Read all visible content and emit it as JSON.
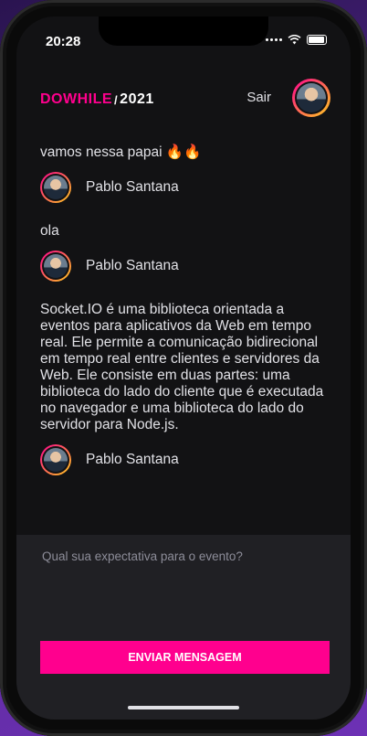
{
  "status_bar": {
    "time": "20:28"
  },
  "header": {
    "logo": {
      "prefix": "DOWHILE",
      "separator": "/",
      "year": "2021"
    },
    "signout_label": "Sair"
  },
  "messages": [
    {
      "text": "vamos nessa papai 🔥🔥",
      "user": "Pablo Santana"
    },
    {
      "text": "ola",
      "user": "Pablo Santana"
    },
    {
      "text": "Socket.IO é uma biblioteca orientada a eventos para aplicativos da Web em tempo real. Ele permite a comunicação bidirecional em tempo real entre clientes e servidores da Web. Ele consiste em duas partes: uma biblioteca do lado do cliente que é executada no navegador e uma biblioteca do lado do servidor para Node.js.",
      "user": "Pablo Santana"
    }
  ],
  "compose": {
    "placeholder": "Qual sua expectativa para o evento?",
    "value": "",
    "send_label": "ENVIAR MENSAGEM"
  },
  "colors": {
    "accent": "#ff008e",
    "accent2": "#ffcd1e",
    "background": "#121214",
    "panel": "#202024"
  }
}
